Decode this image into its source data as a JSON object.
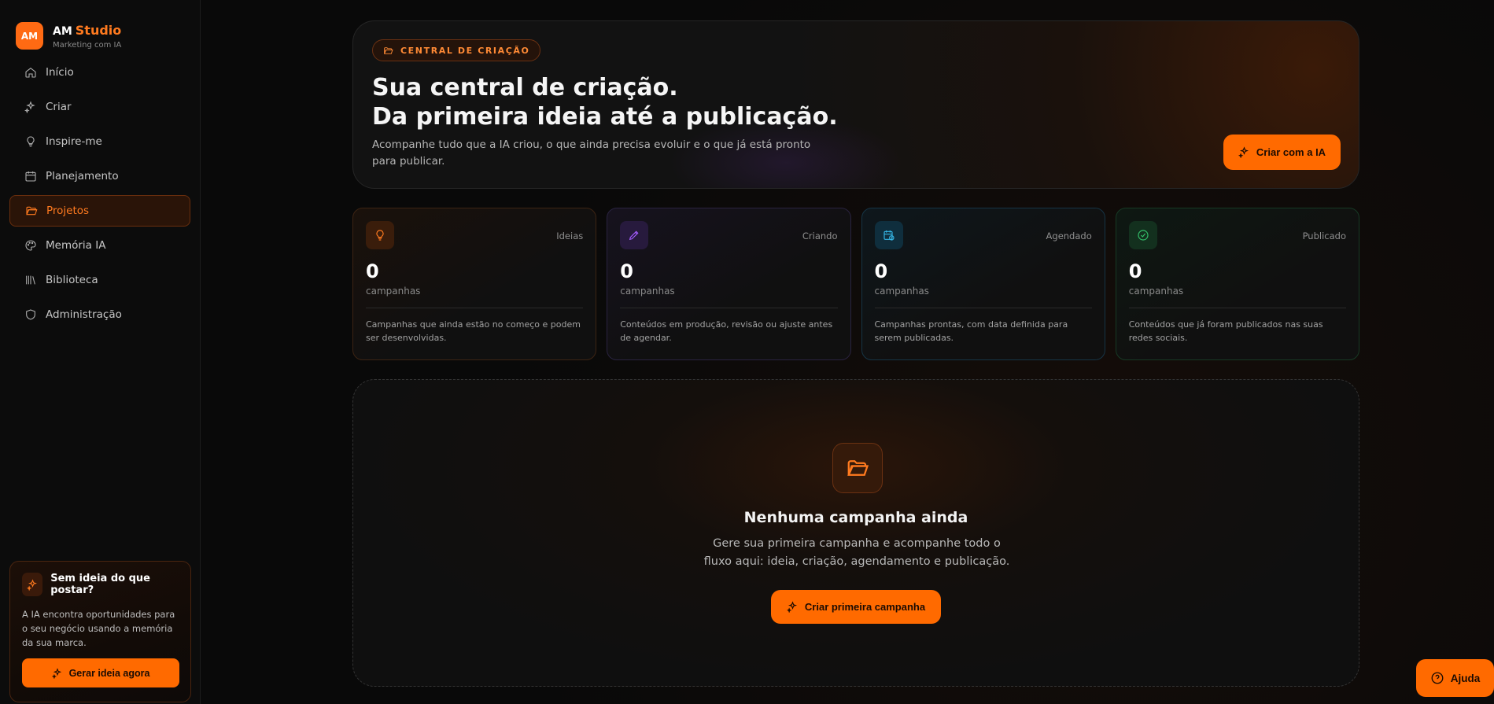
{
  "brand": {
    "logo_text": "AM",
    "name": "AM",
    "name_accent": "Studio",
    "tagline": "Marketing com IA"
  },
  "sidebar": {
    "items": [
      {
        "label": "Início",
        "icon": "home-icon",
        "active": false
      },
      {
        "label": "Criar",
        "icon": "sparkles-icon",
        "active": false
      },
      {
        "label": "Inspire-me",
        "icon": "lightbulb-icon",
        "active": false
      },
      {
        "label": "Planejamento",
        "icon": "calendar-icon",
        "active": false
      },
      {
        "label": "Projetos",
        "icon": "folder-open-icon",
        "active": true
      },
      {
        "label": "Memória IA",
        "icon": "palette-icon",
        "active": false
      },
      {
        "label": "Biblioteca",
        "icon": "library-icon",
        "active": false
      },
      {
        "label": "Administração",
        "icon": "shield-icon",
        "active": false
      }
    ],
    "promo": {
      "title": "Sem ideia do que postar?",
      "text": "A IA encontra oportunidades para o seu negócio usando a memória da sua marca.",
      "button": "Gerar ideia agora"
    }
  },
  "hero": {
    "badge": "CENTRAL DE CRIAÇÃO",
    "title_line1": "Sua central de criação.",
    "title_line2": "Da primeira ideia até a publicação.",
    "subtitle": "Acompanhe tudo que a IA criou, o que ainda precisa evoluir e o que já está pronto para publicar.",
    "button": "Criar com a IA"
  },
  "stats": [
    {
      "tag": "Ideias",
      "value": "0",
      "unit": "campanhas",
      "description": "Campanhas que ainda estão no começo e podem ser desenvolvidas.",
      "icon": "lightbulb-icon"
    },
    {
      "tag": "Criando",
      "value": "0",
      "unit": "campanhas",
      "description": "Conteúdos em produção, revisão ou ajuste antes de agendar.",
      "icon": "pencil-icon"
    },
    {
      "tag": "Agendado",
      "value": "0",
      "unit": "campanhas",
      "description": "Campanhas prontas, com data definida para serem publicadas.",
      "icon": "calendar-clock-icon"
    },
    {
      "tag": "Publicado",
      "value": "0",
      "unit": "campanhas",
      "description": "Conteúdos que já foram publicados nas suas redes sociais.",
      "icon": "check-circle-icon"
    }
  ],
  "empty_state": {
    "title": "Nenhuma campanha ainda",
    "subtitle": "Gere sua primeira campanha e acompanhe todo o fluxo aqui: ideia, criação, agendamento e publicação.",
    "button": "Criar primeira campanha"
  },
  "help": {
    "label": "Ajuda"
  },
  "colors": {
    "accent": "#ff6a00",
    "ideias": "#ff7a1f",
    "criando": "#a45cff",
    "agendado": "#35b6e6",
    "publicado": "#34c26b",
    "background": "#090909"
  }
}
